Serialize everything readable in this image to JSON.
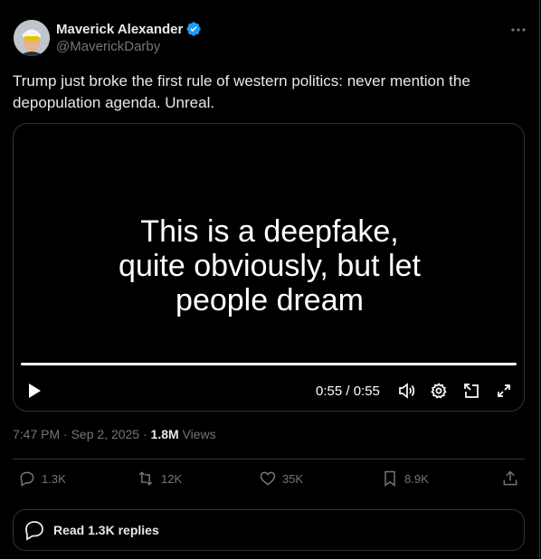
{
  "author": {
    "name": "Maverick Alexander",
    "handle": "@MaverickDarby",
    "verified": true
  },
  "tweet": {
    "text": "Trump just broke the first rule of western politics: never mention the depopulation agenda. Unreal."
  },
  "video": {
    "caption_lines": [
      "This is a deepfake,",
      "quite obviously, but let",
      "people dream"
    ],
    "time": "0:55 / 0:55",
    "progress": 1.0
  },
  "meta": {
    "timestamp": "7:47 PM · Sep 2, 2025 · ",
    "views_count": "1.8M",
    "views_label": " Views"
  },
  "actions": {
    "replies": "1.3K",
    "reposts": "12K",
    "likes": "35K",
    "bookmarks": "8.9K"
  },
  "read_replies": "Read 1.3K replies",
  "colors": {
    "accent": "#1d9bf0",
    "muted": "#71767b",
    "text": "#e7e9ea",
    "border": "#2f3336"
  },
  "icons": [
    "verified-badge-icon",
    "more-icon",
    "play-icon",
    "volume-icon",
    "settings-icon",
    "dock-icon",
    "fullscreen-icon",
    "reply-icon",
    "repost-icon",
    "like-icon",
    "bookmark-icon",
    "share-icon",
    "speech-bubble-icon"
  ]
}
